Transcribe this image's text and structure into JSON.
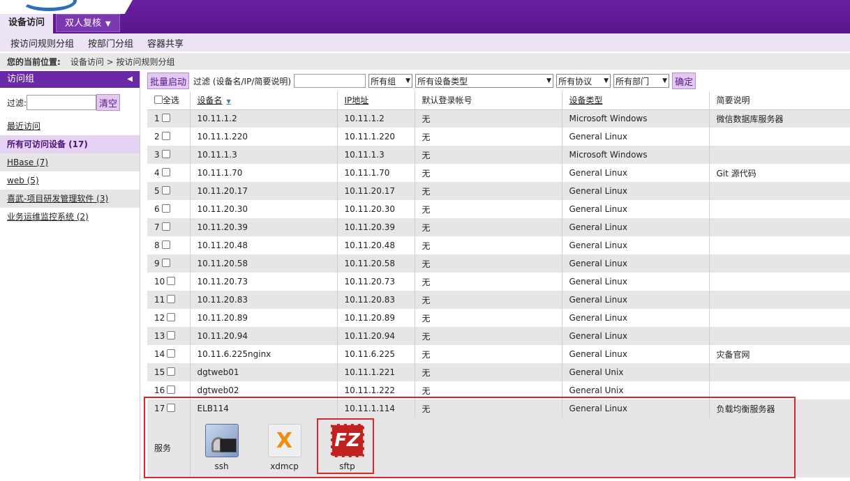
{
  "header": {
    "tabs": [
      {
        "label": "设备访问"
      },
      {
        "label": "双人复核"
      }
    ]
  },
  "subnav": {
    "items": [
      "按访问规则分组",
      "按部门分组",
      "容器共享"
    ]
  },
  "breadcrumb": {
    "label": "您的当前位置:",
    "path": "设备访问 > 按访问规则分组"
  },
  "sidebar": {
    "title": "访问组",
    "filter_label": "过滤:",
    "filter_value": "",
    "clear_label": "清空",
    "items": [
      {
        "label": "最近访问"
      },
      {
        "label": "所有可访问设备 (17)"
      },
      {
        "label": "HBase (7)"
      },
      {
        "label": "web (5)"
      },
      {
        "label": "喜武-项目研发管理软件 (3)"
      },
      {
        "label": "业务运维监控系统 (2)"
      }
    ]
  },
  "toolbar": {
    "batch_label": "批量启动",
    "filter_label": "过滤 (设备名/IP/简要说明)",
    "filter_value": "",
    "group_select": "所有组",
    "type_select": "所有设备类型",
    "protocol_select": "所有协议",
    "dept_select": "所有部门",
    "confirm_label": "确定"
  },
  "table": {
    "headers": {
      "select_all": "全选",
      "name": "设备名",
      "ip": "IP地址",
      "account": "默认登录帐号",
      "type": "设备类型",
      "desc": "简要说明"
    },
    "rows": [
      {
        "n": "1",
        "name": "10.11.1.2",
        "ip": "10.11.1.2",
        "account": "无",
        "type": "Microsoft Windows",
        "desc": "微信数据库服务器"
      },
      {
        "n": "2",
        "name": "10.11.1.220",
        "ip": "10.11.1.220",
        "account": "无",
        "type": "General Linux",
        "desc": ""
      },
      {
        "n": "3",
        "name": "10.11.1.3",
        "ip": "10.11.1.3",
        "account": "无",
        "type": "Microsoft Windows",
        "desc": ""
      },
      {
        "n": "4",
        "name": "10.11.1.70",
        "ip": "10.11.1.70",
        "account": "无",
        "type": "General Linux",
        "desc": "Git 源代码"
      },
      {
        "n": "5",
        "name": "10.11.20.17",
        "ip": "10.11.20.17",
        "account": "无",
        "type": "General Linux",
        "desc": ""
      },
      {
        "n": "6",
        "name": "10.11.20.30",
        "ip": "10.11.20.30",
        "account": "无",
        "type": "General Linux",
        "desc": ""
      },
      {
        "n": "7",
        "name": "10.11.20.39",
        "ip": "10.11.20.39",
        "account": "无",
        "type": "General Linux",
        "desc": ""
      },
      {
        "n": "8",
        "name": "10.11.20.48",
        "ip": "10.11.20.48",
        "account": "无",
        "type": "General Linux",
        "desc": ""
      },
      {
        "n": "9",
        "name": "10.11.20.58",
        "ip": "10.11.20.58",
        "account": "无",
        "type": "General Linux",
        "desc": ""
      },
      {
        "n": "10",
        "name": "10.11.20.73",
        "ip": "10.11.20.73",
        "account": "无",
        "type": "General Linux",
        "desc": ""
      },
      {
        "n": "11",
        "name": "10.11.20.83",
        "ip": "10.11.20.83",
        "account": "无",
        "type": "General Linux",
        "desc": ""
      },
      {
        "n": "12",
        "name": "10.11.20.89",
        "ip": "10.11.20.89",
        "account": "无",
        "type": "General Linux",
        "desc": ""
      },
      {
        "n": "13",
        "name": "10.11.20.94",
        "ip": "10.11.20.94",
        "account": "无",
        "type": "General Linux",
        "desc": ""
      },
      {
        "n": "14",
        "name": "10.11.6.225nginx",
        "ip": "10.11.6.225",
        "account": "无",
        "type": "General Linux",
        "desc": "灾备官网"
      },
      {
        "n": "15",
        "name": "dgtweb01",
        "ip": "10.11.1.221",
        "account": "无",
        "type": "General Unix",
        "desc": ""
      },
      {
        "n": "16",
        "name": "dgtweb02",
        "ip": "10.11.1.222",
        "account": "无",
        "type": "General Unix",
        "desc": ""
      },
      {
        "n": "17",
        "name": "ELB114",
        "ip": "10.11.1.114",
        "account": "无",
        "type": "General Linux",
        "desc": "负载均衡服务器"
      }
    ]
  },
  "services": {
    "label": "服务",
    "items": [
      {
        "name": "ssh",
        "icon": "ssh-terminal-icon"
      },
      {
        "name": "xdmcp",
        "icon": "xdmcp-x-icon"
      },
      {
        "name": "sftp",
        "icon": "filezilla-icon",
        "glyph": "FZ"
      }
    ]
  },
  "colors": {
    "header": "#5a168c",
    "accent": "#6a2aa6",
    "highlight": "#d8262a"
  }
}
